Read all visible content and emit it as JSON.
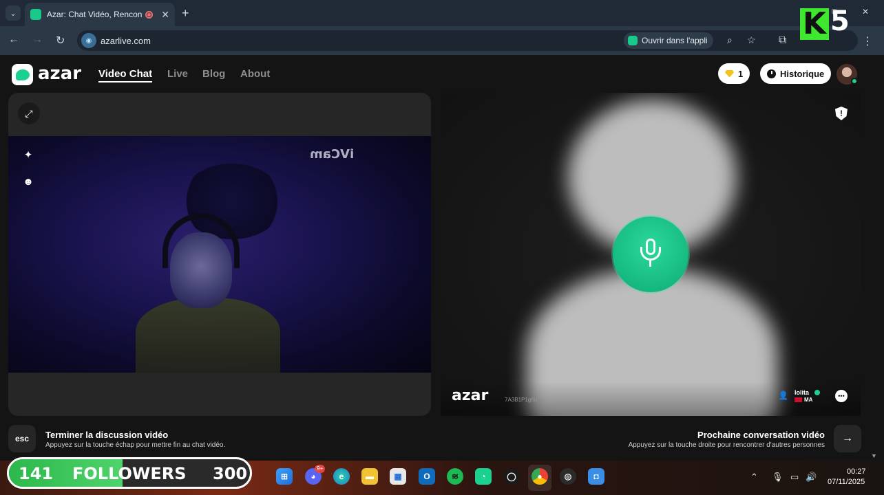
{
  "browser": {
    "tab_title": "Azar: Chat Vidéo, Rencontre",
    "tab_close": "✕",
    "new_tab": "+",
    "url": "azarlive.com",
    "open_in_app": "Ouvrir dans l'appli"
  },
  "overlay": {
    "k5_letter": "K",
    "k5_number": "5"
  },
  "site": {
    "logo_text": "azar",
    "nav": [
      "Video Chat",
      "Live",
      "Blog",
      "About"
    ],
    "gems_count": "1",
    "history_label": "Historique"
  },
  "left_panel": {
    "watermark": "iVCam"
  },
  "right_panel": {
    "brand": "azar",
    "user_code": "7A3B1P1g6u",
    "peer_name": "lolita",
    "peer_country": "MA"
  },
  "hints": {
    "esc_label": "esc",
    "end_title": "Terminer la discussion vidéo",
    "end_sub": "Appuyez sur la touche échap pour mettre fin au chat vidéo.",
    "next_title": "Prochaine conversation vidéo",
    "next_sub": "Appuyez sur la touche droite pour rencontrer d'autres personnes"
  },
  "followers": {
    "current": "141",
    "label": "FOLLOWERS",
    "goal": "300",
    "progress": 0.47
  },
  "taskbar": {
    "discord_badge": "9+",
    "time": "00:27",
    "date": "07/11/2025"
  },
  "colors": {
    "accent": "#1bd18f",
    "mic_green": "#16b97f",
    "followers_green": "#2bb84a"
  }
}
